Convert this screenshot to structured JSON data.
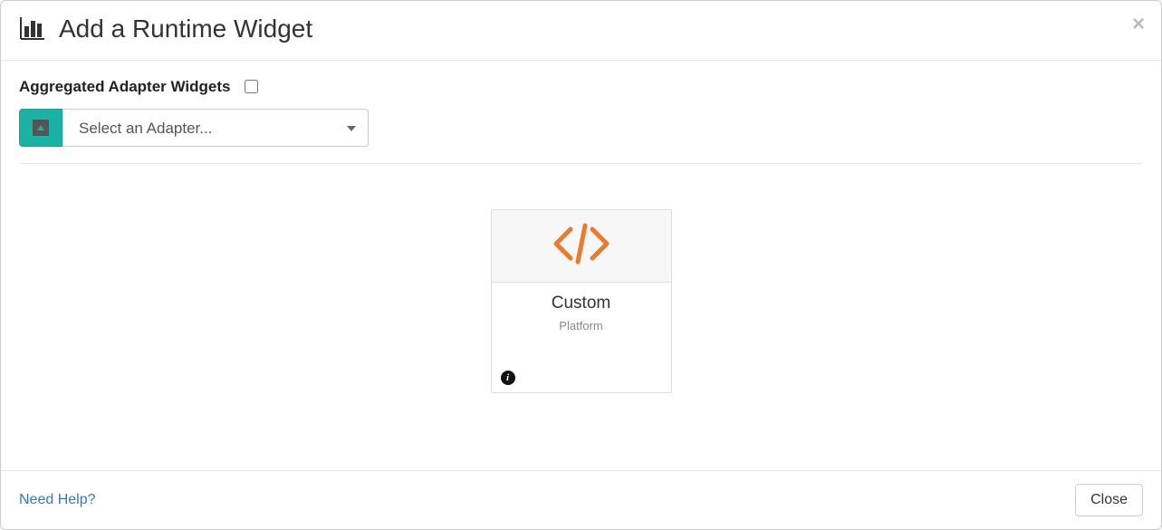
{
  "header": {
    "title": "Add a Runtime Widget"
  },
  "filters": {
    "aggregated_label": "Aggregated Adapter Widgets",
    "aggregated_checked": false,
    "select_placeholder": "Select an Adapter..."
  },
  "cards": [
    {
      "title": "Custom",
      "subtitle": "Platform",
      "icon": "code-icon"
    }
  ],
  "footer": {
    "help_label": "Need Help?",
    "close_label": "Close"
  }
}
